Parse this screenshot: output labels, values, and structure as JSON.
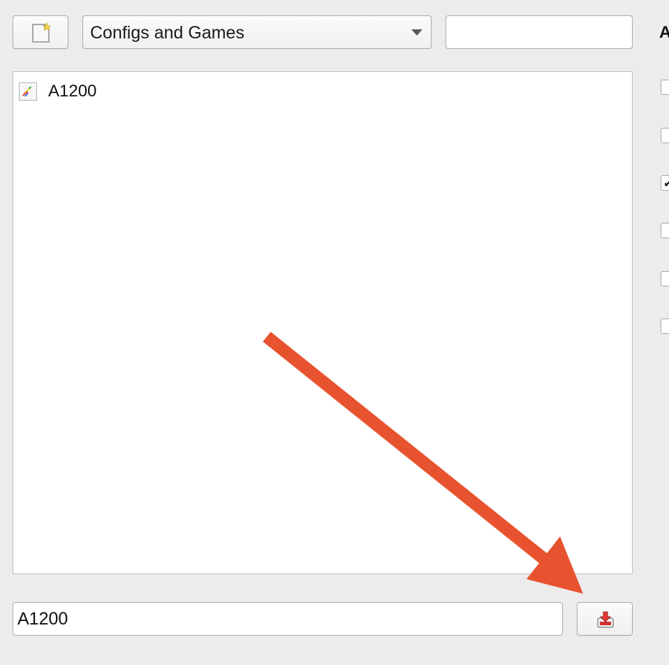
{
  "toolbar": {
    "new_config_icon": "new-document-icon",
    "category_dropdown": {
      "selected": "Configs and Games"
    },
    "search": {
      "value": "",
      "placeholder": ""
    }
  },
  "right_panel": {
    "heading_visible_char": "A",
    "checkboxes": [
      false,
      false,
      true,
      false,
      false,
      false
    ]
  },
  "config_list": {
    "items": [
      {
        "label": "A1200",
        "icon": "amiga-config-icon"
      }
    ]
  },
  "footer": {
    "name_field": {
      "value": "A1200"
    },
    "save_icon": "save-config-icon"
  },
  "annotation": {
    "color": "#e8532f"
  },
  "colors": {
    "window_bg": "#ececec",
    "panel_bg": "#ffffff",
    "border": "#a9a9a9"
  }
}
